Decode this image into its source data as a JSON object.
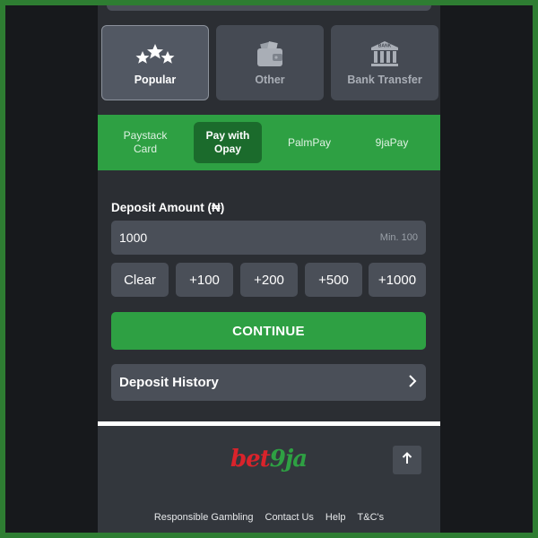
{
  "methods": [
    {
      "label": "Popular",
      "icon": "stars-icon",
      "active": true
    },
    {
      "label": "Other",
      "icon": "wallet-icon",
      "active": false
    },
    {
      "label": "Bank Transfer",
      "icon": "bank-icon",
      "icon_text": "BANK",
      "active": false
    }
  ],
  "providers": [
    {
      "line1": "Paystack",
      "line2": "Card",
      "active": false
    },
    {
      "line1": "Pay with",
      "line2": "Opay",
      "active": true
    },
    {
      "line1": "PalmPay",
      "line2": "",
      "active": false
    },
    {
      "line1": "9jaPay",
      "line2": "",
      "active": false
    }
  ],
  "deposit": {
    "label": "Deposit Amount (₦)",
    "amount_value": "1000",
    "min_label": "Min. 100"
  },
  "quick_amounts": [
    "Clear",
    "+100",
    "+200",
    "+500",
    "+1000"
  ],
  "continue_label": "CONTINUE",
  "history_label": "Deposit History",
  "footer": {
    "logo_part1": "bet",
    "logo_part2": "9ja",
    "links": [
      "Responsible Gambling",
      "Contact Us",
      "Help",
      "T&C's"
    ]
  },
  "colors": {
    "accent_green": "#2ea043",
    "active_tab_green": "#1b6b2c",
    "panel": "#4a4f58",
    "background": "#2b2e33",
    "logo_red": "#d9232b"
  }
}
